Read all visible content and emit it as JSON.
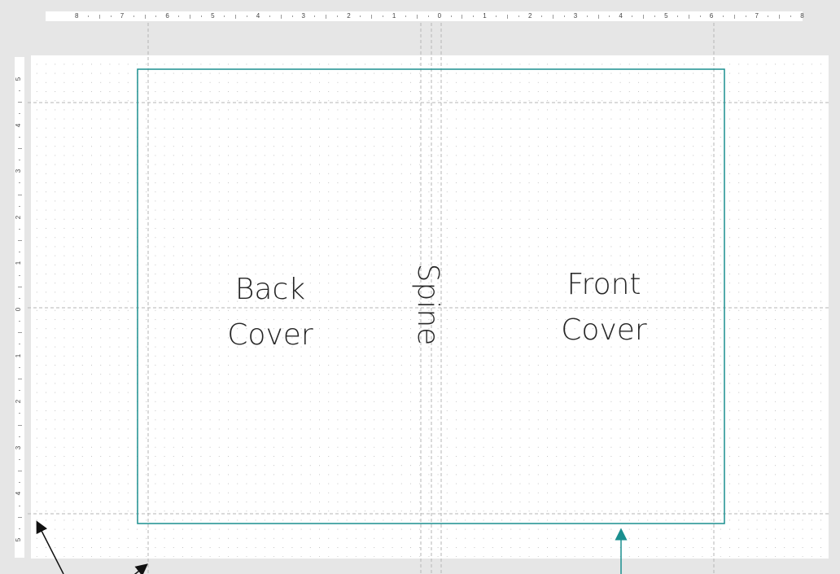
{
  "ruler": {
    "horizontal_labels": [
      "8",
      "7",
      "6",
      "5",
      "4",
      "3",
      "2",
      "1",
      "0",
      "1",
      "2",
      "3",
      "4",
      "5",
      "6",
      "7",
      "8"
    ],
    "vertical_labels": [
      "5",
      "4",
      "3",
      "2",
      "1",
      "0",
      "1",
      "2",
      "3",
      "4",
      "5"
    ]
  },
  "slide": {
    "back_label": "Back\nCover",
    "spine_label": "Spine",
    "front_label": "Front\nCover"
  },
  "colors": {
    "cover_border": "#1a8f8f",
    "guide": "#b8b8b8",
    "grid_dot": "#c8c8c8",
    "arrow_black": "#111111",
    "arrow_teal": "#1a8f8f"
  }
}
